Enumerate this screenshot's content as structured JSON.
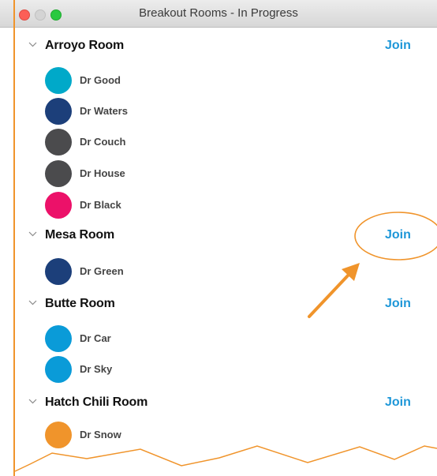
{
  "window": {
    "title": "Breakout Rooms - In Progress"
  },
  "rooms": [
    {
      "name": "Arroyo Room",
      "join": "Join",
      "members": [
        {
          "name": "Dr Good",
          "color": "#00a9c9"
        },
        {
          "name": "Dr Waters",
          "color": "#1c3f7a"
        },
        {
          "name": "Dr Couch",
          "color": "#4b4b4d"
        },
        {
          "name": "Dr House",
          "color": "#4b4b4d"
        },
        {
          "name": "Dr Black",
          "color": "#ec1169"
        }
      ]
    },
    {
      "name": "Mesa Room",
      "join": "Join",
      "members": [
        {
          "name": "Dr Green",
          "color": "#1c3f7a"
        }
      ]
    },
    {
      "name": "Butte Room",
      "join": "Join",
      "members": [
        {
          "name": "Dr Car",
          "color": "#0a9bd8"
        },
        {
          "name": "Dr Sky",
          "color": "#0a9bd8"
        }
      ]
    },
    {
      "name": "Hatch Chili Room",
      "join": "Join",
      "members": [
        {
          "name": "Dr Snow",
          "color": "#f0942b"
        }
      ]
    }
  ],
  "annotation_color": "#f0942b"
}
